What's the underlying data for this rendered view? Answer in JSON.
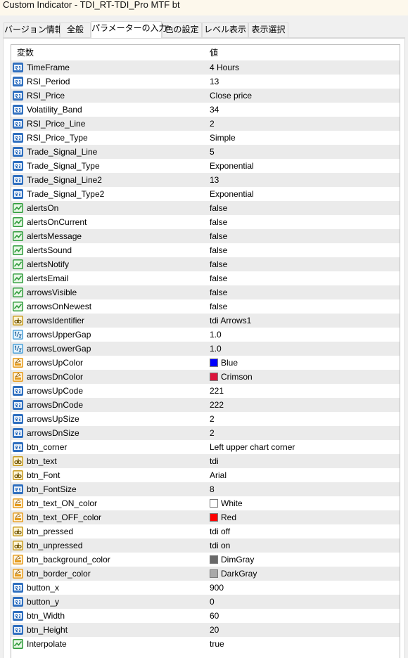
{
  "window": {
    "title": "Custom Indicator - TDI_RT-TDI_Pro MTF bt"
  },
  "tabs": [
    {
      "label": "バージョン情報"
    },
    {
      "label": "全般"
    },
    {
      "label": "パラメーターの入力",
      "active": true
    },
    {
      "label": "色の設定"
    },
    {
      "label": "レベル表示"
    },
    {
      "label": "表示選択"
    }
  ],
  "grid": {
    "headers": {
      "variable": "変数",
      "value": "値"
    },
    "rows": [
      {
        "name": "TimeFrame",
        "value": "4 Hours",
        "type": "int"
      },
      {
        "name": "RSI_Period",
        "value": "13",
        "type": "int"
      },
      {
        "name": "RSI_Price",
        "value": "Close price",
        "type": "int"
      },
      {
        "name": "Volatility_Band",
        "value": "34",
        "type": "int"
      },
      {
        "name": "RSI_Price_Line",
        "value": "2",
        "type": "int"
      },
      {
        "name": "RSI_Price_Type",
        "value": "Simple",
        "type": "int"
      },
      {
        "name": "Trade_Signal_Line",
        "value": "5",
        "type": "int"
      },
      {
        "name": "Trade_Signal_Type",
        "value": "Exponential",
        "type": "int"
      },
      {
        "name": "Trade_Signal_Line2",
        "value": "13",
        "type": "int"
      },
      {
        "name": "Trade_Signal_Type2",
        "value": "Exponential",
        "type": "int"
      },
      {
        "name": "alertsOn",
        "value": "false",
        "type": "bool"
      },
      {
        "name": "alertsOnCurrent",
        "value": "false",
        "type": "bool"
      },
      {
        "name": "alertsMessage",
        "value": "false",
        "type": "bool"
      },
      {
        "name": "alertsSound",
        "value": "false",
        "type": "bool"
      },
      {
        "name": "alertsNotify",
        "value": "false",
        "type": "bool"
      },
      {
        "name": "alertsEmail",
        "value": "false",
        "type": "bool"
      },
      {
        "name": "arrowsVisible",
        "value": "false",
        "type": "bool"
      },
      {
        "name": "arrowsOnNewest",
        "value": "false",
        "type": "bool"
      },
      {
        "name": "arrowsIdentifier",
        "value": "tdi Arrows1",
        "type": "string"
      },
      {
        "name": "arrowsUpperGap",
        "value": "1.0",
        "type": "double"
      },
      {
        "name": "arrowsLowerGap",
        "value": "1.0",
        "type": "double"
      },
      {
        "name": "arrowsUpColor",
        "value": "Blue",
        "type": "color",
        "swatch": "#0000ff"
      },
      {
        "name": "arrowsDnColor",
        "value": "Crimson",
        "type": "color",
        "swatch": "#dc143c"
      },
      {
        "name": "arrowsUpCode",
        "value": "221",
        "type": "int"
      },
      {
        "name": "arrowsDnCode",
        "value": "222",
        "type": "int"
      },
      {
        "name": "arrowsUpSize",
        "value": "2",
        "type": "int"
      },
      {
        "name": "arrowsDnSize",
        "value": "2",
        "type": "int"
      },
      {
        "name": "btn_corner",
        "value": "Left upper chart corner",
        "type": "int"
      },
      {
        "name": "btn_text",
        "value": "tdi",
        "type": "string"
      },
      {
        "name": "btn_Font",
        "value": "Arial",
        "type": "string"
      },
      {
        "name": "btn_FontSize",
        "value": "8",
        "type": "int"
      },
      {
        "name": "btn_text_ON_color",
        "value": "White",
        "type": "color",
        "swatch": "#ffffff"
      },
      {
        "name": "btn_text_OFF_color",
        "value": "Red",
        "type": "color",
        "swatch": "#ff0000"
      },
      {
        "name": "btn_pressed",
        "value": "tdi off",
        "type": "string"
      },
      {
        "name": "btn_unpressed",
        "value": "tdi on",
        "type": "string"
      },
      {
        "name": "btn_background_color",
        "value": "DimGray",
        "type": "color",
        "swatch": "#696969"
      },
      {
        "name": "btn_border_color",
        "value": "DarkGray",
        "type": "color",
        "swatch": "#a9a9a9"
      },
      {
        "name": "button_x",
        "value": "900",
        "type": "int"
      },
      {
        "name": "button_y",
        "value": "0",
        "type": "int"
      },
      {
        "name": "btn_Width",
        "value": "60",
        "type": "int"
      },
      {
        "name": "btn_Height",
        "value": "20",
        "type": "int"
      },
      {
        "name": "Interpolate",
        "value": "true",
        "type": "bool"
      }
    ]
  },
  "icons": {
    "int": "integer-type-icon",
    "bool": "boolean-type-icon",
    "string": "string-type-icon",
    "double": "double-type-icon",
    "color": "color-type-icon"
  },
  "colors": {
    "int_icon": "#2f6fbf",
    "bool_icon": "#2e9b3a",
    "string_icon": "#c79a1c",
    "double_icon": "#4aa0d8",
    "color_icon": "#e59a1a"
  }
}
